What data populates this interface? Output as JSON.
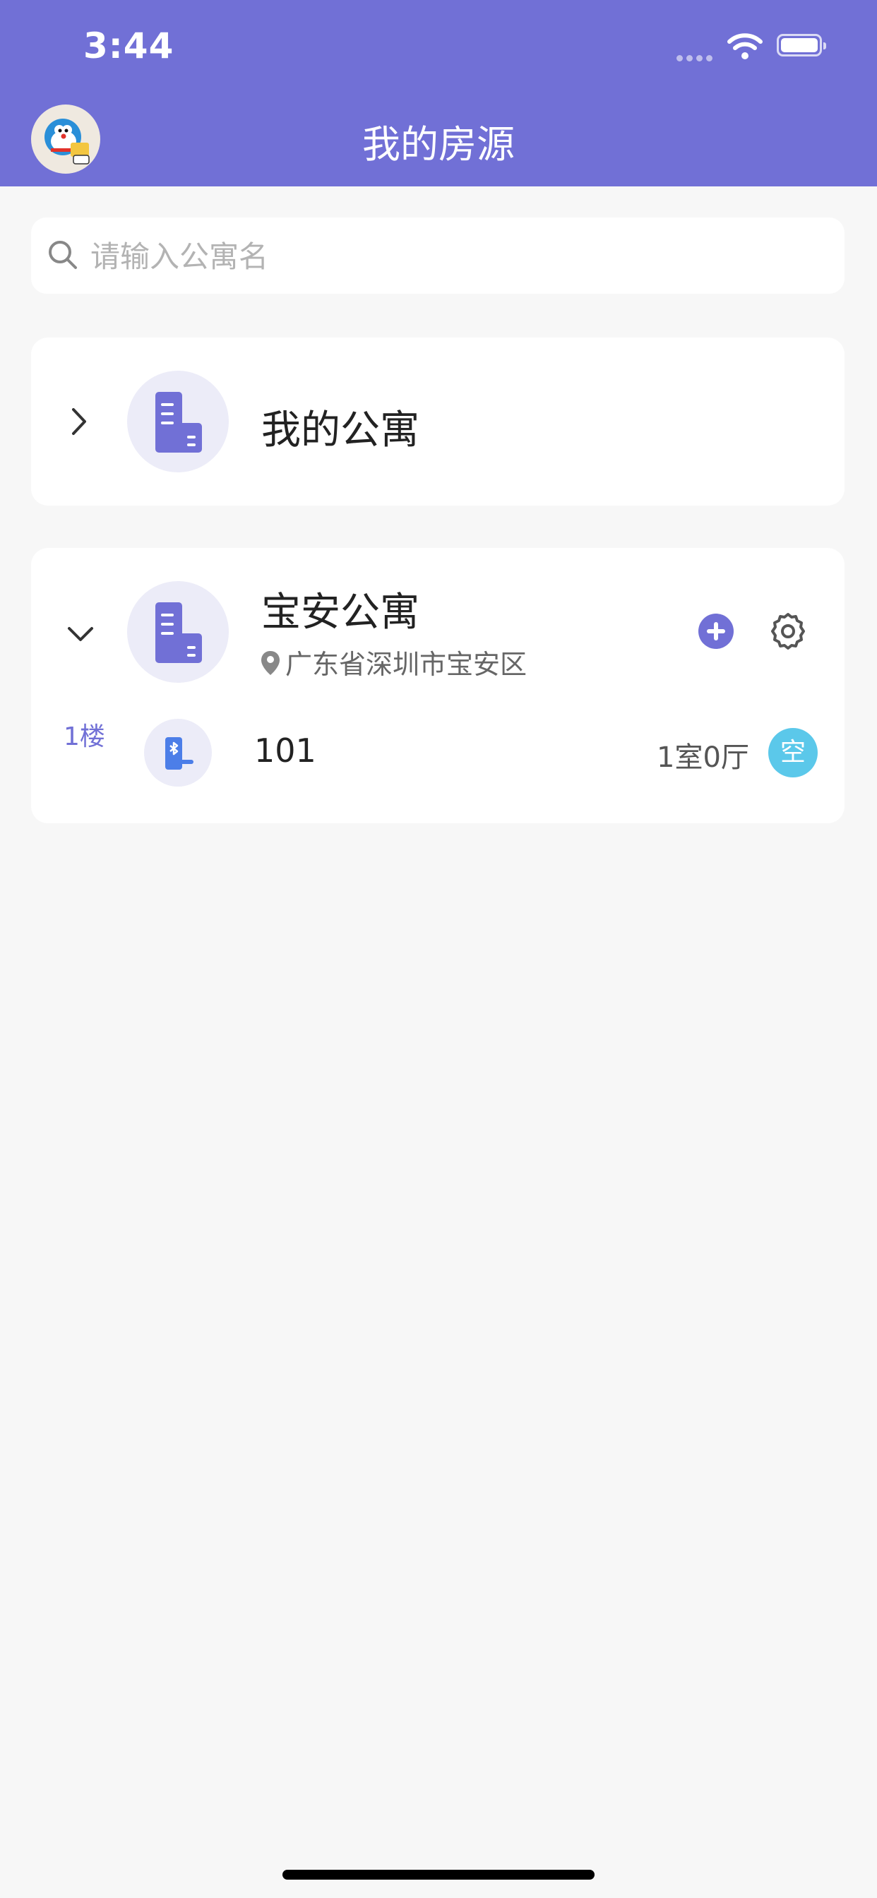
{
  "status_bar": {
    "time": "3:44"
  },
  "header": {
    "title": "我的房源"
  },
  "search": {
    "placeholder": "请输入公寓名",
    "value": ""
  },
  "apartments": [
    {
      "name": "我的公寓",
      "expanded": false
    },
    {
      "name": "宝安公寓",
      "expanded": true,
      "address": "广东省深圳市宝安区",
      "floors": [
        {
          "label": "1楼",
          "rooms": [
            {
              "number": "101",
              "layout": "1室0厅",
              "status": "空"
            }
          ]
        }
      ]
    }
  ],
  "colors": {
    "primary": "#7170d6",
    "status_empty": "#5bc8ea",
    "background": "#f7f7f7"
  }
}
